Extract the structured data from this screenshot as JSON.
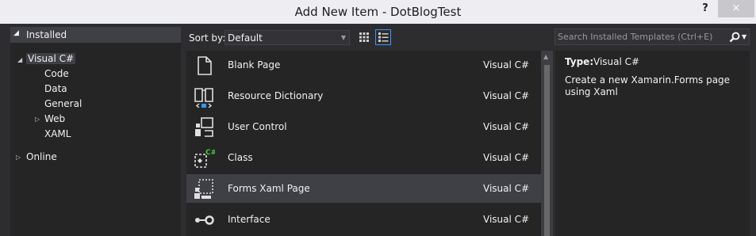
{
  "window": {
    "title": "Add New Item - DotBlogTest",
    "help": "?",
    "close": "×"
  },
  "left_pane": {
    "header": "Installed",
    "tree": [
      {
        "label": "Visual C#"
      },
      {
        "label": "Code"
      },
      {
        "label": "Data"
      },
      {
        "label": "General"
      },
      {
        "label": "Web"
      },
      {
        "label": "XAML"
      },
      {
        "label": "Online"
      }
    ]
  },
  "toolbar": {
    "sort_label": "Sort by:",
    "sort_value": "Default",
    "view_mode": "list"
  },
  "search": {
    "placeholder": "Search Installed Templates (Ctrl+E)"
  },
  "templates": [
    {
      "name": "Blank Page",
      "lang": "Visual C#",
      "icon": "blank-page-icon"
    },
    {
      "name": "Resource Dictionary",
      "lang": "Visual C#",
      "icon": "resource-dictionary-icon"
    },
    {
      "name": "User Control",
      "lang": "Visual C#",
      "icon": "user-control-icon"
    },
    {
      "name": "Class",
      "lang": "Visual C#",
      "icon": "class-icon"
    },
    {
      "name": "Forms Xaml Page",
      "lang": "Visual C#",
      "icon": "forms-xaml-page-icon",
      "selected": true
    },
    {
      "name": "Interface",
      "lang": "Visual C#",
      "icon": "interface-icon"
    }
  ],
  "details": {
    "type_label": "Type:",
    "type_value": "Visual C#",
    "description": "Create a new Xamarin.Forms page using Xaml"
  },
  "colors": {
    "selection": "#3f3f46",
    "accent": "#3399ff",
    "cs_badge": "#4ec43d",
    "background": "#2d2d30",
    "pane": "#252526"
  }
}
